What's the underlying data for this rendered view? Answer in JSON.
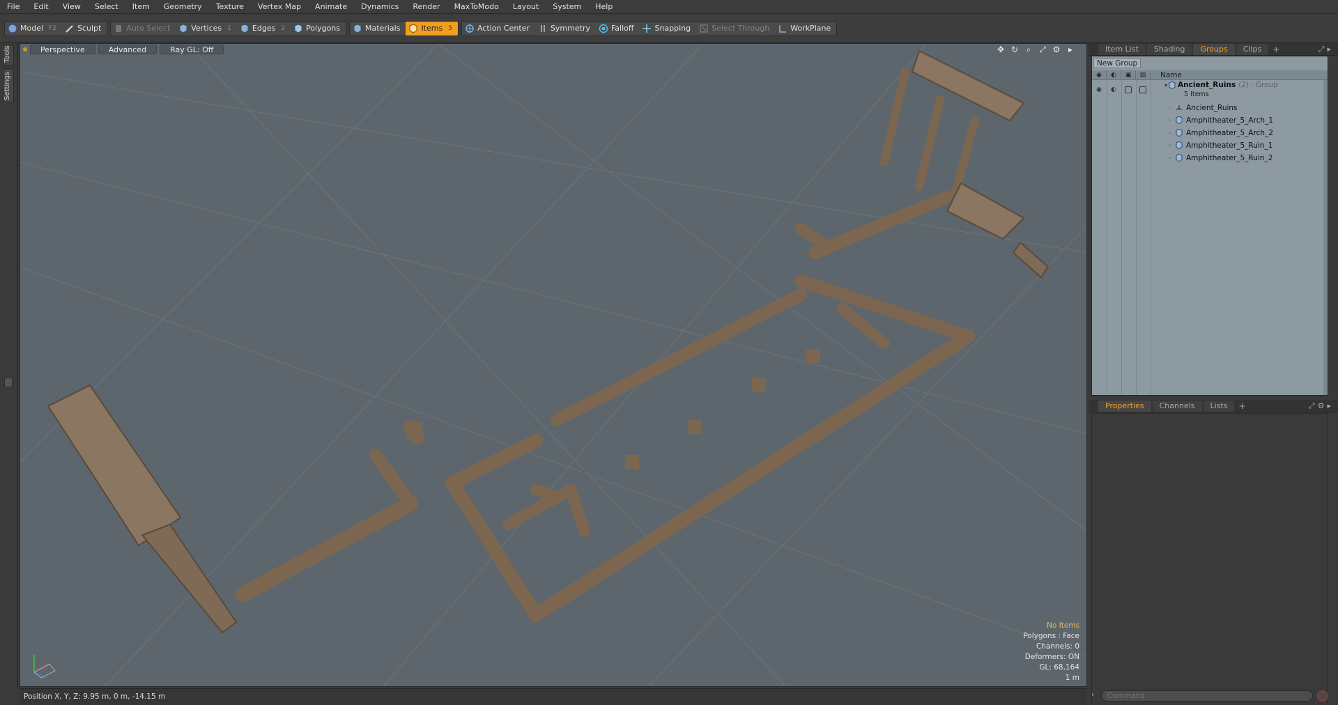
{
  "menu": [
    "File",
    "Edit",
    "View",
    "Select",
    "Item",
    "Geometry",
    "Texture",
    "Vertex Map",
    "Animate",
    "Dynamics",
    "Render",
    "MaxToModo",
    "Layout",
    "System",
    "Help"
  ],
  "toolbar": {
    "model": "Model",
    "model_key": "F2",
    "sculpt": "Sculpt",
    "auto_select": "Auto Select",
    "vertices": "Vertices",
    "vertices_key": "1",
    "edges": "Edges",
    "edges_key": "2",
    "polygons": "Polygons",
    "materials": "Materials",
    "items": "Items",
    "items_key": "5",
    "action_center": "Action Center",
    "symmetry": "Symmetry",
    "falloff": "Falloff",
    "snapping": "Snapping",
    "select_through": "Select Through",
    "workplane": "WorkPlane",
    "active_color": "#f0a020"
  },
  "left_strip": {
    "tools": "Tools",
    "settings": "Settings"
  },
  "viewport": {
    "view": "Perspective",
    "shading": "Advanced",
    "raygl": "Ray GL: Off",
    "background_color": "#5d666c",
    "stats": {
      "no_items": "No Items",
      "polygons": "Polygons : Face",
      "channels": "Channels: 0",
      "deformers": "Deformers: ON",
      "gl": "GL: 68,164",
      "scale": "1 m"
    }
  },
  "statusbar": {
    "position": "Position X, Y, Z:  9.95 m, 0 m, -14.15 m"
  },
  "right_panel": {
    "top_tabs": [
      {
        "label": "Item List",
        "active": false
      },
      {
        "label": "Shading",
        "active": false
      },
      {
        "label": "Groups",
        "active": true
      },
      {
        "label": "Clips",
        "active": false
      }
    ],
    "new_group": "New Group",
    "name_header": "Name",
    "group": {
      "name": "Ancient_Ruins",
      "count": "(2)",
      "type": ": Group",
      "items_count": "5 Items"
    },
    "items": [
      "Ancient_Ruins",
      "Amphitheater_5_Arch_1",
      "Amphitheater_5_Arch_2",
      "Amphitheater_5_Ruin_1",
      "Amphitheater_5_Ruin_2"
    ],
    "bottom_tabs": [
      {
        "label": "Properties",
        "active": true
      },
      {
        "label": "Channels",
        "active": false
      },
      {
        "label": "Lists",
        "active": false
      }
    ],
    "command_placeholder": "Command"
  }
}
